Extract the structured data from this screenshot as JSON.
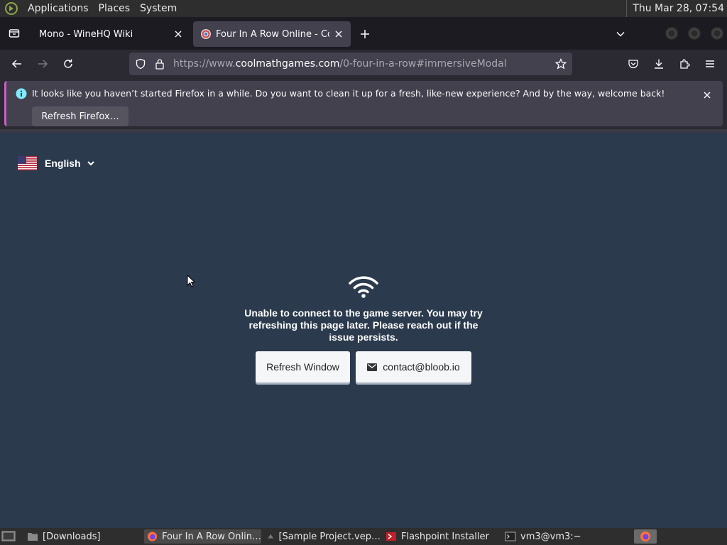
{
  "top_panel": {
    "menus": [
      "Applications",
      "Places",
      "System"
    ],
    "clock": "Thu Mar 28, 07:54"
  },
  "tabs": [
    {
      "title": "Mono - WineHQ Wiki",
      "active": false
    },
    {
      "title": "Four In A Row Online - Conn",
      "active": true
    }
  ],
  "urlbar": {
    "prefix": "https://www.",
    "host": "coolmathgames.com",
    "path": "/0-four-in-a-row#immersiveModal"
  },
  "notification": {
    "message": "It looks like you haven’t started Firefox in a while. Do you want to clean it up for a fresh, like-new experience? And by the way, welcome back!",
    "button_label": "Refresh Firefox…"
  },
  "page": {
    "language": "English",
    "error_message": "Unable to connect to the game server. You may try refreshing this page later. Please reach out if the issue persists.",
    "refresh_button": "Refresh Window",
    "contact_button": "contact@bloob.io"
  },
  "taskbar": {
    "items": [
      {
        "label": "[Downloads]",
        "icon": "folder-icon",
        "active": false
      },
      {
        "label": "Four In A Row Onlin…",
        "icon": "firefox-icon",
        "active": true
      },
      {
        "label": "[Sample Project.vep…",
        "icon": "app-icon",
        "active": false
      },
      {
        "label": "Flashpoint Installer",
        "icon": "installer-icon",
        "active": false
      },
      {
        "label": "vm3@vm3:~",
        "icon": "terminal-icon",
        "active": false
      }
    ]
  },
  "colors": {
    "page_bg": "#2b3a4d",
    "browser_chrome": "#2b2a33",
    "notification_accent": "#cf5ec8",
    "button_bg": "#f4f6f8"
  }
}
